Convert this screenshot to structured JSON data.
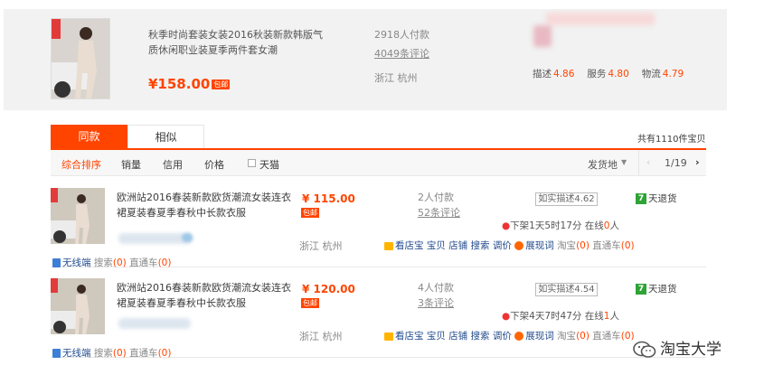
{
  "top": {
    "title": "秋季时尚套装女装2016秋装新款韩版气质休闲职业装夏季两件套女潮",
    "price": "¥158.00",
    "free_shipping_tag": "包邮",
    "paid_count": "2918人付款",
    "comments": "4049条评论",
    "location": "浙江 杭州",
    "ratings": [
      {
        "label": "描述",
        "value": "4.86"
      },
      {
        "label": "服务",
        "value": "4.80"
      },
      {
        "label": "物流",
        "value": "4.79"
      }
    ]
  },
  "tabs": [
    {
      "label": "同款",
      "active": true
    },
    {
      "label": "相似",
      "active": false
    }
  ],
  "total_count": "共有1110件宝贝",
  "sort": {
    "items": [
      "综合排序",
      "销量",
      "信用",
      "价格"
    ],
    "tmall_label": "天猫",
    "ship_from": "发货地",
    "pager_prev": "‹",
    "pager": "1/19",
    "pager_next": "›"
  },
  "rows": [
    {
      "title": "欧洲站2016春装新款欧货潮流女装连衣裙夏装春夏季春秋中长款衣服",
      "price": "¥ 115.00",
      "tag": "包邮",
      "paid": "2人付款",
      "comments": "52条评论",
      "desc_rating": "如实描述4.62",
      "time_prefix": "下架",
      "time_value": "1天5时17分",
      "online_prefix": "在线",
      "online_count": "0",
      "online_suffix": "人",
      "return_badge": "7",
      "return_label": "天退货",
      "location": "浙江 杭州",
      "links_store": "看店宝",
      "links_items": [
        "宝贝",
        "店铺",
        "搜索",
        "调价"
      ],
      "links_exp": "展现词",
      "taobao_label": "淘宝",
      "taobao_count": "(0)",
      "ztc_label": "直通车",
      "ztc_count": "(0)",
      "wireless": "无线端",
      "search_label": "搜索",
      "search_count": "(0)"
    },
    {
      "title": "欧洲站2016春装新款欧货潮流女装连衣裙夏装春夏季春秋中长款衣服",
      "price": "¥ 120.00",
      "tag": "包邮",
      "paid": "4人付款",
      "comments": "3条评论",
      "desc_rating": "如实描述4.54",
      "time_prefix": "下架",
      "time_value": "4天7时47分",
      "online_prefix": "在线",
      "online_count": "1",
      "online_suffix": "人",
      "return_badge": "7",
      "return_label": "天退货",
      "location": "浙江 杭州",
      "links_store": "看店宝",
      "links_items": [
        "宝贝",
        "店铺",
        "搜索",
        "调价"
      ],
      "links_exp": "展现词",
      "taobao_label": "淘宝",
      "taobao_count": "(0)",
      "ztc_label": "直通车",
      "ztc_count": "(0)",
      "wireless": "无线端",
      "search_label": "搜索",
      "search_count": "(0)"
    }
  ],
  "watermark": "淘宝大学",
  "colors": {
    "accent": "#ff4400",
    "panel": "#f2f2f2",
    "link": "#224b8c",
    "badge_green": "#2ea336"
  }
}
